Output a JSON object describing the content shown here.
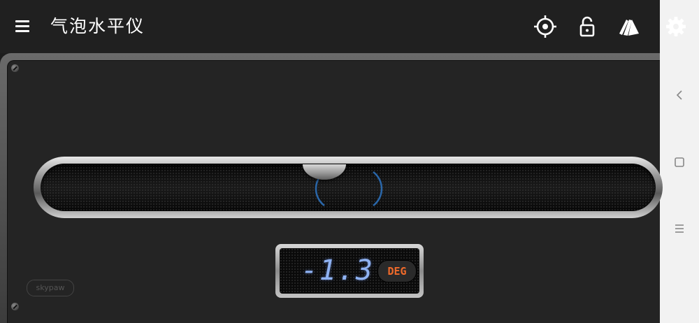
{
  "app": {
    "title": "气泡水平仪"
  },
  "toolbar": {
    "menu_icon": "hamburger-menu-icon",
    "calibrate_icon": "crosshair-icon",
    "lock_icon": "unlock-icon",
    "theme_icon": "cards-icon",
    "settings_icon": "gear-icon"
  },
  "level": {
    "reading": "-1.3",
    "unit": "DEG",
    "brand": "skypaw",
    "colors": {
      "reading": "#8fb2f2",
      "unit": "#f06a2a",
      "indicator": "#2a66a8"
    }
  },
  "navbar": {
    "back_icon": "chevron-left-icon",
    "home_icon": "square-icon",
    "recents_icon": "lines-icon"
  }
}
